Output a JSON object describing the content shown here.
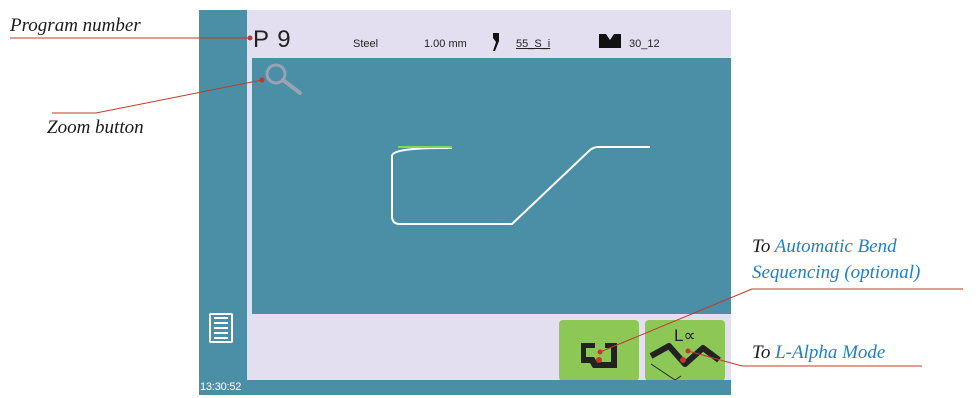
{
  "annotations": {
    "program_number": "Program number",
    "zoom_button": "Zoom button",
    "abs_prefix": "To ",
    "abs_link_line1": "Automatic Bend",
    "abs_link_line2": "Sequencing (optional)",
    "lalpha_prefix": "To ",
    "lalpha_link": "L-Alpha Mode"
  },
  "header": {
    "program": "P 9",
    "material": "Steel",
    "thickness": "1.00 mm",
    "punch": "55_S_i",
    "die": "30_12"
  },
  "status": {
    "time": "13:30:52"
  },
  "buttons": {
    "lalpha_label": "L∝"
  },
  "colors": {
    "panel_blue": "#4a8fa5",
    "screen_bg": "#e4dff0",
    "button_green": "#8dc857",
    "accent_orange": "#e8772e",
    "link_blue": "#1f7fc8"
  },
  "icons": {
    "zoom": "magnifier-icon",
    "menu": "list-icon",
    "program_list": "stacked-pages-icon",
    "punch": "punch-tool-icon",
    "die": "die-tool-icon",
    "abs": "bend-sequence-icon",
    "lalpha": "bend-angle-icon"
  }
}
